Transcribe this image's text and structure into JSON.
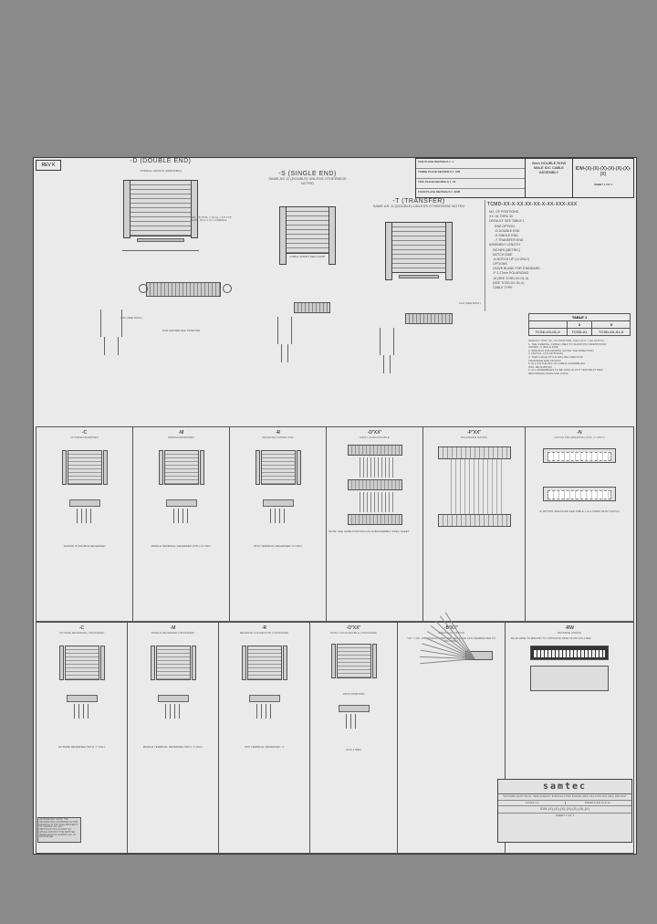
{
  "rev": "REV K",
  "title_block": {
    "row1_left": "ONE PLACE DECIMALS ± .1",
    "row1_right": "THREE PLACE DECIMALS ± .005",
    "row2_left": "TWO PLACE DECIMALS ± .01",
    "row2_right": "FOUR PLACE DECIMALS ± .0005",
    "mid": "2mm DOUBLE ROW MALE IDC CABLE ASSEMBLY",
    "drawing_no": "IDM-(X)-(X)-(X)-(X)-(X)-(X)-(X)",
    "sheet": "SHEET 1 OF 1"
  },
  "sections": {
    "d": {
      "title": "-D (DOUBLE END)",
      "note1": "(NO. OF POS. × 2mm) + 6.5 TYP",
      "note2": "(GAP - 5mm × 2) = OVERALL",
      "label_len": "OVERALL LENGTH (SPECIFIED)",
      "pcb_note": "PCB CENTER REF POSITION",
      "lbl": "LOC.(SEE DWG.)"
    },
    "s": {
      "title": "-S (SINGLE END)",
      "sub": "SAME AS -D (DOUBLE) UNLESS OTHERWISE NOTED",
      "note": "CABLE VARIES SEE CHART"
    },
    "t": {
      "title": "-T (TRANSFER)",
      "sub": "SAME AS -D (DOUBLE) UNLESS OTHERWISE NOTED",
      "note": "LOC.(SEE DWG.)"
    }
  },
  "legend": {
    "partno": "TCMD-XX-X-XX.XX-XX-X-XX-XXX-XXX",
    "lines": [
      "NO. OF POSITIONS",
      "XX: 04 THRU 30",
      "DEFAULT: SEE TABLE 1",
      "END OPTION",
      "-D DOUBLE END",
      "-S SINGLE END",
      "-T TRANSFER END",
      "ASSEMBLY LENGTH",
      "INCHES (METRIC)",
      "NOTCH SIDE",
      "-N NOTCH UP (-N ONLY)",
      "OPTIONS",
      "LEAVE BLANK FOR STANDARD",
      "-P 1.27mm POLARIZING",
      "-M (SEE TCSD-XX-01-X)",
      "(SEE TCSD-XX-S1-X)",
      "CABLE TYPE"
    ]
  },
  "table1": {
    "title": "TABLE 1",
    "headers": [
      "",
      "2",
      "3"
    ],
    "rows": [
      [
        "TCSD-XX-01-X",
        "TCSD-01",
        "TCSD-XX-01-X"
      ]
    ]
  },
  "notes": [
    "SPECIFY \"POL\" IN –XX POSITION. CALL OUT = NO NOTCH",
    "1. THE OVERALL CABLE USED TO SHOW PIN ORIENTATION",
    "   UNDER –T (MALE END)",
    "2. SPECIFIC POLARIZING ALONG THE DIRECTION",
    "3. NOTCH –N IS OPTIONAL",
    "4. THRU HOLE STYLE WILL BE USED FOR",
    "   TRANSFER END OPTION",
    "5. ALL ON THE IDC-XX CABLE ASSEMBLIES",
    "   WILL BE SHIPPED",
    "6. ALL ASSEMBLIES TO BE 100% HI-POT TESTED AT 500V",
    "   RECORDING PASS AND CONS"
  ],
  "mid_cells": [
    {
      "code": "-C",
      "label": "OUTSIDE REVERSED",
      "foot": "SHOWN IN DOUBLE REVERSED"
    },
    {
      "code": "-M",
      "label": "MIDDLE REVERSED",
      "foot": "MIDDLE TERMINAL REVERSED WITH -D ONLY"
    },
    {
      "code": "-R",
      "label": "REVERSE CONNECTOR",
      "foot": "WITH TERMINAL REVERSED -D ONLY"
    },
    {
      "code": "-D\"XX\"",
      "label": "DAISY CHAIN-DOUBLE",
      "foot": "NOTE: SEE SAME POSITION ON SUBASSEMBLY SPEC SHEET"
    },
    {
      "code": "-P\"XX\"",
      "label": "POLARIZED MATING"
    },
    {
      "code": "-N",
      "label": "NOTCH POLARIZATION (TOP –T ONLY)",
      "foot": "IF OPTION SPECIFIED SEE TABLE 1 ALL SIDES MUST MATCH"
    }
  ],
  "bot_cells": [
    {
      "code": "-C",
      "label": "OUTSIDE REVERSED (TRANSFER)",
      "foot": "OUTSIDE REVERSED WITH -T ONLY"
    },
    {
      "code": "-M",
      "label": "MIDDLE REVERSED (TRANSFER)",
      "foot": "MIDDLE TERMINAL REVERSED WITH -T ONLY"
    },
    {
      "code": "-R",
      "label": "REVERSE CONNECTOR (TRANSFER)",
      "foot": "SMT TERMINAL REVERSED -T"
    },
    {
      "code": "-D\"XX\"",
      "label": "DAISY CHAIN-DOUBLE (TRANSFER)",
      "foot_a": "FIRST POSITION",
      "foot_b": "(LOC 1 REF)"
    },
    {
      "code": "-B\"XX\"",
      "label": "BREAKOUT OPTION",
      "note": "\"XX\" = NO. OF CONDUCTORS PER LEG EACH LEG TERMINATED TO IDC CONN."
    },
    {
      "code": "-RW",
      "label": "REVERSE WIRING",
      "note": "BLUE WIRE TO BROWN TO OPPOSITE SIDE OF PIN NO.1 REF"
    }
  ],
  "samtec": {
    "logo": "samtec",
    "addr": "520 PARK EAST BLVD, NEW ALBANY, INDIANA 47150 PHONE (812) 944-6733 FAX (812) 948-5047",
    "scale": "SCALE 2:1",
    "by": "PRODUCED 11-5-12",
    "dwg": "IDM-(X)-(X)-(X)-(X)-(X)-(X)-(X)",
    "sheet": "SHEET 1 OF 1"
  },
  "proprietary": "PROPRIETARY NOTE: THE INFORMATION CONTAINED IN THIS DRAWING IS THE SOLE PROPERTY OF SAMTEC INC. ANY REPRODUCTION IN PART OR WHOLE WITHOUT THE WRITTEN PERMISSION OF SAMTEC INC. IS PROHIBITED.",
  "colors": {
    "bg": "#8a8a8a",
    "sheet": "#eaeaea",
    "line": "#3a3a3a"
  }
}
